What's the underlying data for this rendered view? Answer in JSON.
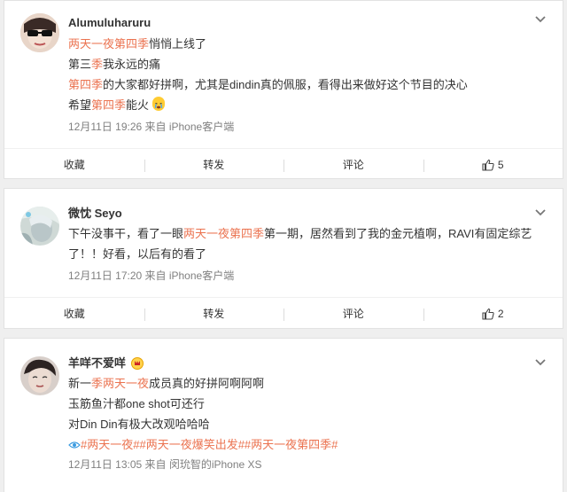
{
  "posts": [
    {
      "username": "Alumuluharuru",
      "lines": [
        [
          {
            "t": "两天一夜第四季",
            "hl": true
          },
          {
            "t": "悄悄上线了",
            "hl": false
          }
        ],
        [
          {
            "t": "第三",
            "hl": false
          },
          {
            "t": "季",
            "hl": true
          },
          {
            "t": "我永远的痛",
            "hl": false
          }
        ],
        [
          {
            "t": "第四季",
            "hl": true
          },
          {
            "t": "的大家都好拼啊，尤其是dindin真的佩服，看得出来做好这个节目的决心",
            "hl": false
          }
        ],
        [
          {
            "t": "希望",
            "hl": false
          },
          {
            "t": "第四季",
            "hl": true
          },
          {
            "t": "能火",
            "hl": false
          }
        ]
      ],
      "meta": "12月11日 19:26  来自 iPhone客户端",
      "actions": {
        "collect": "收藏",
        "repost": "转发",
        "comment": "评论",
        "like": "5"
      }
    },
    {
      "username": "微忱 Seyo",
      "lines": [
        [
          {
            "t": "下午没事干，看了一眼",
            "hl": false
          },
          {
            "t": "两天一夜第四季",
            "hl": true
          },
          {
            "t": "第一期，居然看到了我的金元植啊，RAVI有固定综艺",
            "hl": false
          }
        ],
        [
          {
            "t": "了！！好看，以后有的看了",
            "hl": false
          }
        ]
      ],
      "meta": "12月11日 17:20  来自 iPhone客户端",
      "actions": {
        "collect": "收藏",
        "repost": "转发",
        "comment": "评论",
        "like": "2"
      }
    },
    {
      "username": "羊咩不爱咩",
      "lines": [
        [
          {
            "t": "新一",
            "hl": false
          },
          {
            "t": "季两天一夜",
            "hl": true
          },
          {
            "t": "成员真的好拼阿啊阿啊",
            "hl": false
          }
        ],
        [
          {
            "t": "玉筋鱼汁都one shot可还行",
            "hl": false
          }
        ],
        [
          {
            "t": "对Din Din有极大改观哈哈哈",
            "hl": false
          }
        ]
      ],
      "topics": "#两天一夜##两天一夜爆笑出发##两天一夜第四季#",
      "meta": "12月11日 13:05  来自 闵玧智的iPhone XS"
    }
  ],
  "colors": {
    "highlight": "#eb7350",
    "meta": "#808080"
  }
}
